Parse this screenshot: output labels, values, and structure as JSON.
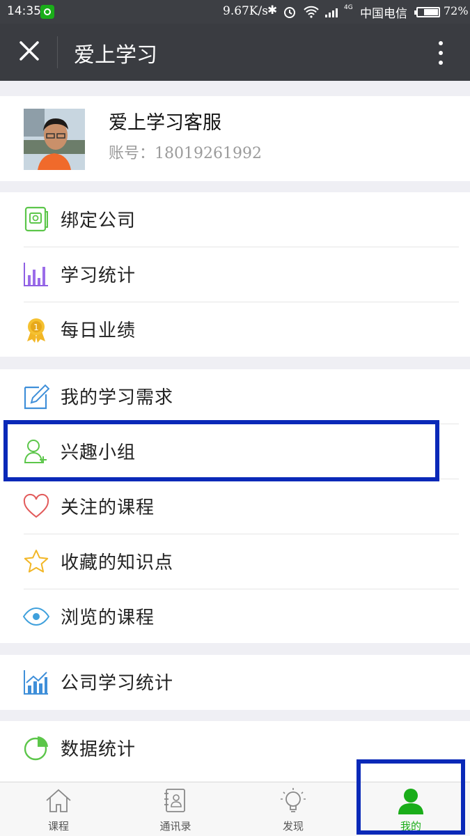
{
  "status_bar": {
    "time": "14:35",
    "net_speed": "9.67K/s",
    "carrier": "中国电信",
    "battery": "72%",
    "battery_level": 0.72,
    "signal_type": "4G"
  },
  "nav": {
    "title": "爱上学习"
  },
  "profile": {
    "name": "爱上学习客服",
    "account": "账号：18019261992"
  },
  "menu": {
    "group1": [
      {
        "label": "绑定公司",
        "icon": "company-icon"
      },
      {
        "label": "学习统计",
        "icon": "bar-chart-icon"
      },
      {
        "label": "每日业绩",
        "icon": "medal-icon"
      }
    ],
    "group2": [
      {
        "label": "我的学习需求",
        "icon": "edit-icon"
      },
      {
        "label": "兴趣小组",
        "icon": "add-user-icon"
      },
      {
        "label": "关注的课程",
        "icon": "heart-icon"
      },
      {
        "label": "收藏的知识点",
        "icon": "star-icon"
      },
      {
        "label": "浏览的课程",
        "icon": "eye-icon"
      }
    ],
    "group3": [
      {
        "label": "公司学习统计",
        "icon": "trend-chart-icon"
      }
    ],
    "group4": [
      {
        "label": "数据统计",
        "icon": "pie-chart-icon"
      }
    ]
  },
  "tabs": [
    {
      "label": "课程",
      "icon": "home-icon",
      "active": false
    },
    {
      "label": "通讯录",
      "icon": "contacts-icon",
      "active": false
    },
    {
      "label": "发现",
      "icon": "bulb-icon",
      "active": false
    },
    {
      "label": "我的",
      "icon": "person-icon",
      "active": true
    }
  ],
  "colors": {
    "nav_bg": "#3a3c41",
    "accent_green": "#1aad19",
    "highlight_blue": "#0a29b8"
  }
}
